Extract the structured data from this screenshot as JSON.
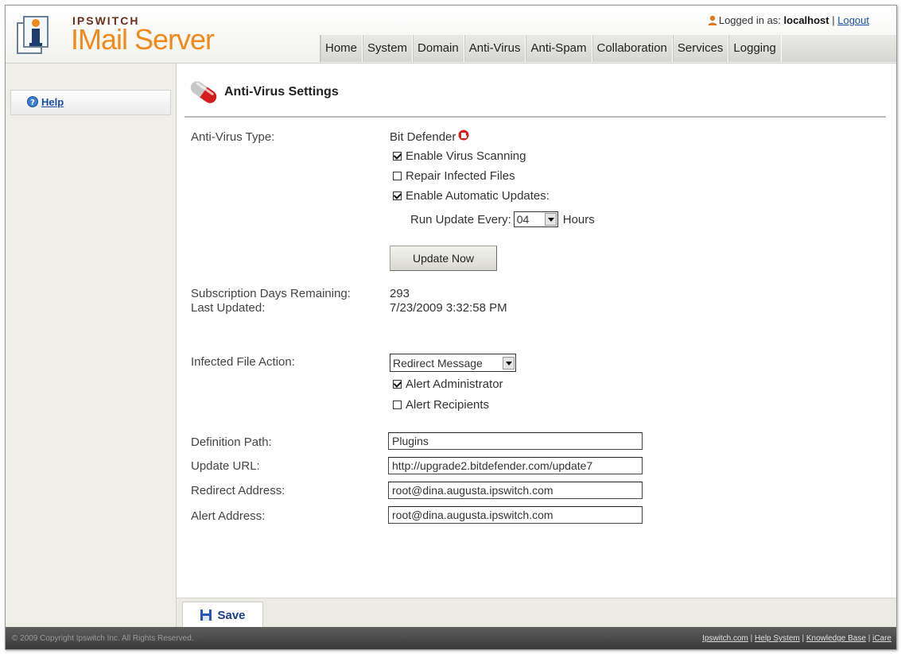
{
  "header": {
    "brand": "IPSWITCH",
    "product": "IMail Server",
    "login_prefix": "Logged in as:",
    "username": "localhost",
    "logout": "Logout",
    "nav": [
      "Home",
      "System",
      "Domain",
      "Anti-Virus",
      "Anti-Spam",
      "Collaboration",
      "Services",
      "Logging"
    ]
  },
  "sidebar": {
    "help": "Help"
  },
  "page": {
    "title": "Anti-Virus Settings"
  },
  "settings": {
    "av_type_label": "Anti-Virus Type:",
    "av_type_value": "Bit Defender",
    "enable_scanning": {
      "label": "Enable Virus Scanning",
      "checked": true
    },
    "repair_files": {
      "label": "Repair Infected Files",
      "checked": false
    },
    "auto_updates": {
      "label": "Enable Automatic Updates:",
      "checked": true
    },
    "run_update_label": "Run Update Every:",
    "run_update_value": "04",
    "hours_label": "Hours",
    "update_now": "Update Now",
    "subscription_label": "Subscription Days Remaining:",
    "subscription_value": "293",
    "last_updated_label": "Last Updated:",
    "last_updated_value": "7/23/2009 3:32:58 PM",
    "infected_action_label": "Infected File Action:",
    "infected_action_value": "Redirect Message",
    "alert_admin": {
      "label": "Alert Administrator",
      "checked": true
    },
    "alert_recipients": {
      "label": "Alert Recipients",
      "checked": false
    },
    "definition_path_label": "Definition Path:",
    "definition_path_value": "Plugins",
    "update_url_label": "Update URL:",
    "update_url_value": "http://upgrade2.bitdefender.com/update7",
    "redirect_address_label": "Redirect Address:",
    "redirect_address_value": "root@dina.augusta.ipswitch.com",
    "alert_address_label": "Alert Address:",
    "alert_address_value": "root@dina.augusta.ipswitch.com"
  },
  "save_label": "Save",
  "footer": {
    "copyright": "© 2009 Copyright Ipswitch Inc. All Rights Reserved.",
    "links": [
      "Ipswitch.com",
      "Help System",
      "Knowledge Base",
      "iCare"
    ]
  },
  "colors": {
    "accent_orange": "#f08a1a",
    "link_blue": "#1a4fa8",
    "sidebar_bg": "#efeee6",
    "footer_bg": "#3a3a3a"
  }
}
